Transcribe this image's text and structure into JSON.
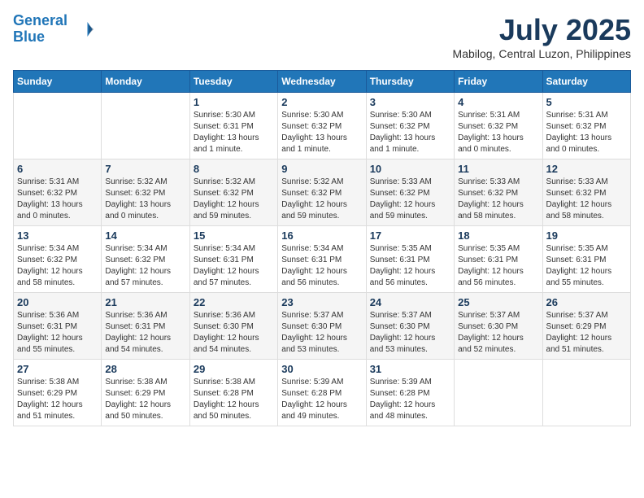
{
  "logo": {
    "line1": "General",
    "line2": "Blue"
  },
  "title": "July 2025",
  "subtitle": "Mabilog, Central Luzon, Philippines",
  "days_header": [
    "Sunday",
    "Monday",
    "Tuesday",
    "Wednesday",
    "Thursday",
    "Friday",
    "Saturday"
  ],
  "weeks": [
    [
      {
        "num": "",
        "sunrise": "",
        "sunset": "",
        "daylight": ""
      },
      {
        "num": "",
        "sunrise": "",
        "sunset": "",
        "daylight": ""
      },
      {
        "num": "1",
        "sunrise": "Sunrise: 5:30 AM",
        "sunset": "Sunset: 6:31 PM",
        "daylight": "Daylight: 13 hours and 1 minute."
      },
      {
        "num": "2",
        "sunrise": "Sunrise: 5:30 AM",
        "sunset": "Sunset: 6:32 PM",
        "daylight": "Daylight: 13 hours and 1 minute."
      },
      {
        "num": "3",
        "sunrise": "Sunrise: 5:30 AM",
        "sunset": "Sunset: 6:32 PM",
        "daylight": "Daylight: 13 hours and 1 minute."
      },
      {
        "num": "4",
        "sunrise": "Sunrise: 5:31 AM",
        "sunset": "Sunset: 6:32 PM",
        "daylight": "Daylight: 13 hours and 0 minutes."
      },
      {
        "num": "5",
        "sunrise": "Sunrise: 5:31 AM",
        "sunset": "Sunset: 6:32 PM",
        "daylight": "Daylight: 13 hours and 0 minutes."
      }
    ],
    [
      {
        "num": "6",
        "sunrise": "Sunrise: 5:31 AM",
        "sunset": "Sunset: 6:32 PM",
        "daylight": "Daylight: 13 hours and 0 minutes."
      },
      {
        "num": "7",
        "sunrise": "Sunrise: 5:32 AM",
        "sunset": "Sunset: 6:32 PM",
        "daylight": "Daylight: 13 hours and 0 minutes."
      },
      {
        "num": "8",
        "sunrise": "Sunrise: 5:32 AM",
        "sunset": "Sunset: 6:32 PM",
        "daylight": "Daylight: 12 hours and 59 minutes."
      },
      {
        "num": "9",
        "sunrise": "Sunrise: 5:32 AM",
        "sunset": "Sunset: 6:32 PM",
        "daylight": "Daylight: 12 hours and 59 minutes."
      },
      {
        "num": "10",
        "sunrise": "Sunrise: 5:33 AM",
        "sunset": "Sunset: 6:32 PM",
        "daylight": "Daylight: 12 hours and 59 minutes."
      },
      {
        "num": "11",
        "sunrise": "Sunrise: 5:33 AM",
        "sunset": "Sunset: 6:32 PM",
        "daylight": "Daylight: 12 hours and 58 minutes."
      },
      {
        "num": "12",
        "sunrise": "Sunrise: 5:33 AM",
        "sunset": "Sunset: 6:32 PM",
        "daylight": "Daylight: 12 hours and 58 minutes."
      }
    ],
    [
      {
        "num": "13",
        "sunrise": "Sunrise: 5:34 AM",
        "sunset": "Sunset: 6:32 PM",
        "daylight": "Daylight: 12 hours and 58 minutes."
      },
      {
        "num": "14",
        "sunrise": "Sunrise: 5:34 AM",
        "sunset": "Sunset: 6:32 PM",
        "daylight": "Daylight: 12 hours and 57 minutes."
      },
      {
        "num": "15",
        "sunrise": "Sunrise: 5:34 AM",
        "sunset": "Sunset: 6:31 PM",
        "daylight": "Daylight: 12 hours and 57 minutes."
      },
      {
        "num": "16",
        "sunrise": "Sunrise: 5:34 AM",
        "sunset": "Sunset: 6:31 PM",
        "daylight": "Daylight: 12 hours and 56 minutes."
      },
      {
        "num": "17",
        "sunrise": "Sunrise: 5:35 AM",
        "sunset": "Sunset: 6:31 PM",
        "daylight": "Daylight: 12 hours and 56 minutes."
      },
      {
        "num": "18",
        "sunrise": "Sunrise: 5:35 AM",
        "sunset": "Sunset: 6:31 PM",
        "daylight": "Daylight: 12 hours and 56 minutes."
      },
      {
        "num": "19",
        "sunrise": "Sunrise: 5:35 AM",
        "sunset": "Sunset: 6:31 PM",
        "daylight": "Daylight: 12 hours and 55 minutes."
      }
    ],
    [
      {
        "num": "20",
        "sunrise": "Sunrise: 5:36 AM",
        "sunset": "Sunset: 6:31 PM",
        "daylight": "Daylight: 12 hours and 55 minutes."
      },
      {
        "num": "21",
        "sunrise": "Sunrise: 5:36 AM",
        "sunset": "Sunset: 6:31 PM",
        "daylight": "Daylight: 12 hours and 54 minutes."
      },
      {
        "num": "22",
        "sunrise": "Sunrise: 5:36 AM",
        "sunset": "Sunset: 6:30 PM",
        "daylight": "Daylight: 12 hours and 54 minutes."
      },
      {
        "num": "23",
        "sunrise": "Sunrise: 5:37 AM",
        "sunset": "Sunset: 6:30 PM",
        "daylight": "Daylight: 12 hours and 53 minutes."
      },
      {
        "num": "24",
        "sunrise": "Sunrise: 5:37 AM",
        "sunset": "Sunset: 6:30 PM",
        "daylight": "Daylight: 12 hours and 53 minutes."
      },
      {
        "num": "25",
        "sunrise": "Sunrise: 5:37 AM",
        "sunset": "Sunset: 6:30 PM",
        "daylight": "Daylight: 12 hours and 52 minutes."
      },
      {
        "num": "26",
        "sunrise": "Sunrise: 5:37 AM",
        "sunset": "Sunset: 6:29 PM",
        "daylight": "Daylight: 12 hours and 51 minutes."
      }
    ],
    [
      {
        "num": "27",
        "sunrise": "Sunrise: 5:38 AM",
        "sunset": "Sunset: 6:29 PM",
        "daylight": "Daylight: 12 hours and 51 minutes."
      },
      {
        "num": "28",
        "sunrise": "Sunrise: 5:38 AM",
        "sunset": "Sunset: 6:29 PM",
        "daylight": "Daylight: 12 hours and 50 minutes."
      },
      {
        "num": "29",
        "sunrise": "Sunrise: 5:38 AM",
        "sunset": "Sunset: 6:28 PM",
        "daylight": "Daylight: 12 hours and 50 minutes."
      },
      {
        "num": "30",
        "sunrise": "Sunrise: 5:39 AM",
        "sunset": "Sunset: 6:28 PM",
        "daylight": "Daylight: 12 hours and 49 minutes."
      },
      {
        "num": "31",
        "sunrise": "Sunrise: 5:39 AM",
        "sunset": "Sunset: 6:28 PM",
        "daylight": "Daylight: 12 hours and 48 minutes."
      },
      {
        "num": "",
        "sunrise": "",
        "sunset": "",
        "daylight": ""
      },
      {
        "num": "",
        "sunrise": "",
        "sunset": "",
        "daylight": ""
      }
    ]
  ]
}
